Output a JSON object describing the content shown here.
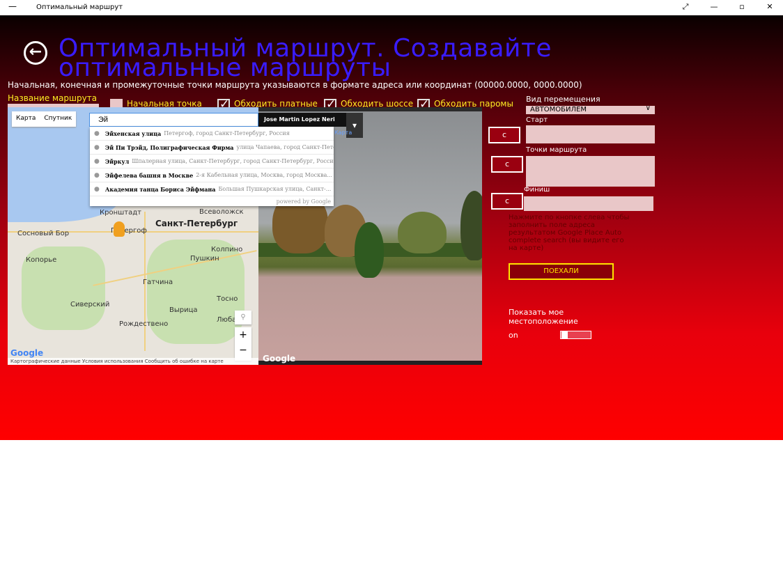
{
  "window": {
    "title": "Оптимальный маршрут",
    "minimize_glyph": "—",
    "controls": [
      "⤢",
      "—",
      "▫",
      "✕"
    ]
  },
  "header": {
    "back_glyph": "←",
    "title": "Оптимальный маршрут. Создавайте оптимальные маршруты"
  },
  "hint": "Начальная, конечная и промежуточные точки маршрута указываются в формате адреса или координат  (00000.0000, 0000.0000)",
  "route_name_label": "Название маршрута",
  "checkboxes": [
    {
      "label": "Начальная точка мое местоположение",
      "checked": false
    },
    {
      "label": "Обходить платные дороги",
      "checked": true
    },
    {
      "label": "Обходить шоссе",
      "checked": true
    },
    {
      "label": "Обходить паромы",
      "checked": true
    }
  ],
  "travel_mode": {
    "label": "Вид перемещения",
    "value": "АВТОМОБИЛЕМ"
  },
  "fields": {
    "start_label": "Старт",
    "waypoints_label": "Точки маршрута",
    "finish_label": "Финиш",
    "c_label": "c"
  },
  "note": "Нажмите по кнопке слева чтобы заполнить поле адреса результатом Google Place Auto complete search (вы видите его на карте)",
  "go_button": "ПОЕХАЛИ",
  "show_location": {
    "label": "Показать мое местоположение",
    "state": "on"
  },
  "map": {
    "type_buttons": [
      "Карта",
      "Спутник"
    ],
    "labels": {
      "kronstadt": "Кронштадт",
      "peterhof": "Петергоф",
      "spb": "Санкт-Петербург",
      "vsevolozhsk": "Всеволожск",
      "kolpino": "Колпино",
      "pushkin": "Пушкин",
      "sosnovy_bor": "Сосновый Бор",
      "koporye": "Копорье",
      "gatchina": "Гатчина",
      "siverskiy": "Сиверский",
      "vyritsa": "Вырица",
      "rozhdestveno": "Рождествено",
      "lyuban": "Любань",
      "tosno": "Тосно"
    },
    "footer": "Картографические данные   Условия использования   Сообщить об ошибке на карте",
    "logo": "Google",
    "zoom_in": "+",
    "zoom_out": "−"
  },
  "street_view": {
    "caption": "Jose Martin Lopez Neri",
    "link": "Карта",
    "logo": "Google"
  },
  "search": {
    "value": "Эй"
  },
  "suggestions": [
    {
      "main": "Эйхенская улица",
      "sub": "Петергоф, город Санкт-Петербург, Россия"
    },
    {
      "main": "Эй Пи Трэйд, Полиграфическая Фирма",
      "sub": "улица Чапаева, город Санкт-Петер..."
    },
    {
      "main": "Эйркул",
      "sub": "Шпалерная улица, Санкт-Петербург, город Санкт-Петербург, Росси"
    },
    {
      "main": "Эйфелева башня в Москве",
      "sub": "2-я Кабельная улица, Москва, город Москва..."
    },
    {
      "main": "Академия танца Бориса Эйфмана",
      "sub": "Большая Пушкарская улица, Санкт-..."
    }
  ],
  "powered_by": "powered by Google"
}
